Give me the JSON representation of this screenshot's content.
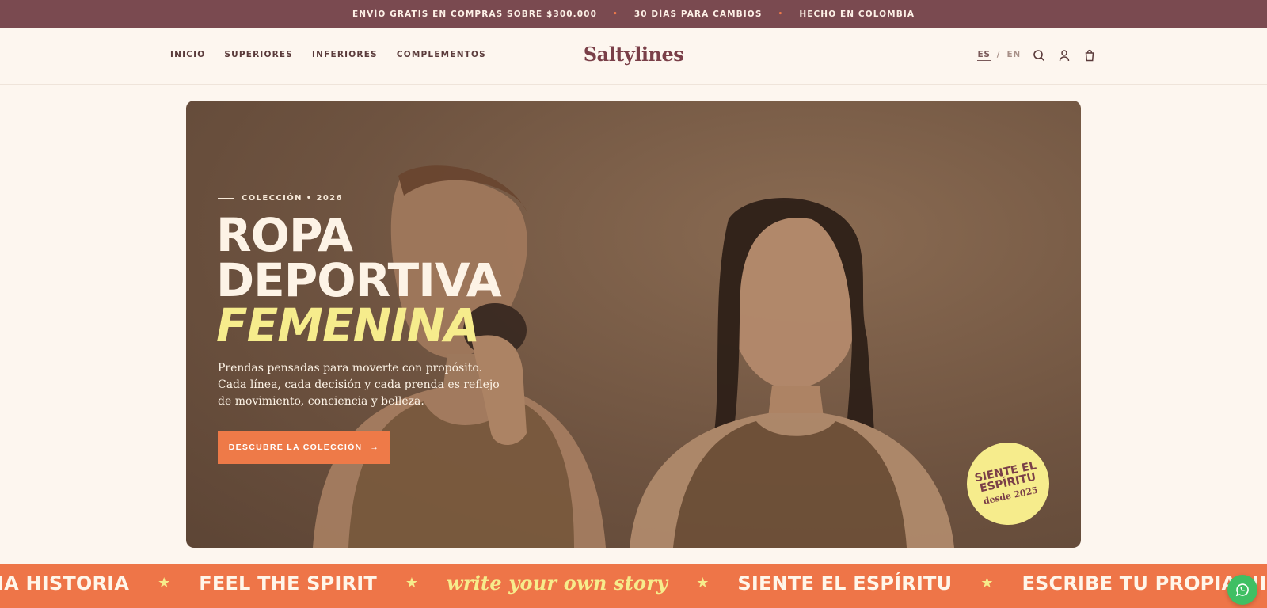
{
  "announcement": {
    "items": [
      "ENVÍO GRATIS EN COMPRAS SOBRE $300.000",
      "30 DÍAS PARA CAMBIOS",
      "HECHO EN COLOMBIA"
    ],
    "separator": "•"
  },
  "header": {
    "nav": [
      "INICIO",
      "SUPERIORES",
      "INFERIORES",
      "COMPLEMENTOS"
    ],
    "logo": "Saltylines",
    "lang": {
      "active": "ES",
      "separator": "/",
      "other": "EN"
    },
    "icons": [
      "search-icon",
      "account-icon",
      "cart-icon"
    ]
  },
  "hero": {
    "kicker": "COLECCIÓN • 2026",
    "title_line1": "ROPA",
    "title_line2": "DEPORTIVA",
    "title_accent": "FEMENINA",
    "lead": "Prendas pensadas para moverte con propósito. Cada línea, cada decisión y cada prenda es reflejo de movimiento, conciencia y belleza.",
    "cta": "DESCUBRE LA COLECCIÓN",
    "cta_arrow": "→",
    "badge_line1": "SIENTE EL",
    "badge_line2": "ESPÍRITU",
    "badge_line3": "desde 2025"
  },
  "marquee": {
    "items": [
      "IA HISTORIA",
      "FEEL THE SPIRIT",
      "write your own story",
      "SIENTE EL ESPÍRITU",
      "ESCRIBE TU PROPIA HISTORIA"
    ],
    "star": "★"
  },
  "colors": {
    "announce_bg": "#7a4a50",
    "accent_orange": "#ee7548",
    "accent_yellow": "#f6ec8c",
    "logo": "#7a3f48",
    "whatsapp": "#3fbf63"
  }
}
